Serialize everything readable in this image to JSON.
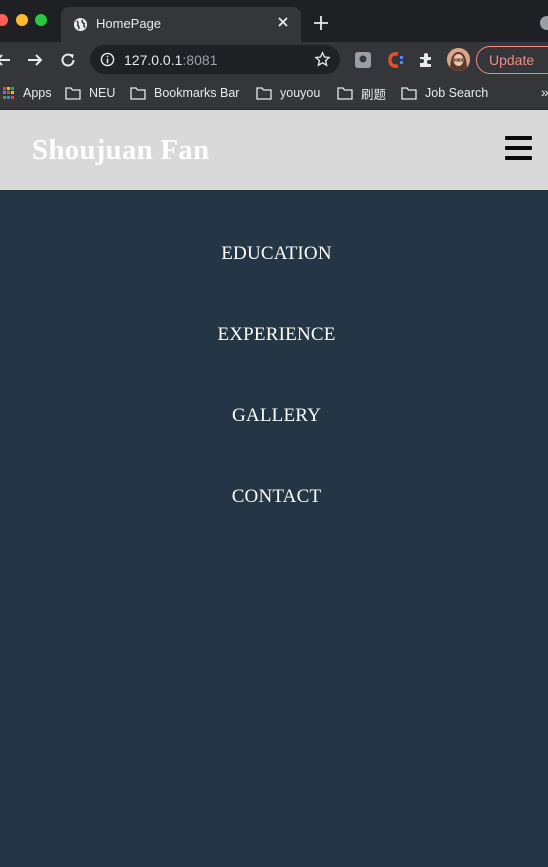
{
  "browser": {
    "tab": {
      "title": "HomePage",
      "favicon": "globe-icon"
    },
    "address": {
      "host": "127.0.0.1",
      "port": ":8081"
    },
    "update_label": "Update",
    "bookmarks": [
      "Apps",
      "NEU",
      "Bookmarks Bar",
      "youyou",
      "刷题",
      "Job Search"
    ],
    "bookmarks_more": "»",
    "colors": {
      "tabstrip": "#1f2023",
      "toolbar": "#35363a",
      "update_accent": "#f28b82"
    }
  },
  "site": {
    "title": "Shoujuan Fan",
    "menu_icon": "hamburger-icon",
    "nav": [
      "EDUCATION",
      "EXPERIENCE",
      "GALLERY",
      "CONTACT"
    ],
    "colors": {
      "header_bg": "#d9d9d9",
      "panel_bg": "#243646",
      "text": "#ffffff"
    }
  }
}
